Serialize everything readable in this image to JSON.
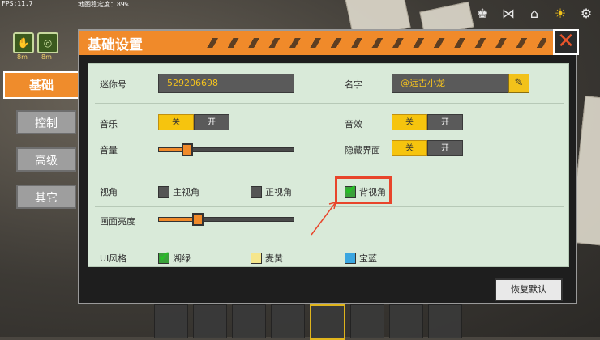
{
  "hud": {
    "fps": "FPS:11.7",
    "stability": "地图稳定度：89%"
  },
  "buffs": [
    {
      "icon": "hunger-icon",
      "time": "8m"
    },
    {
      "icon": "spiral-icon",
      "time": "8m"
    }
  ],
  "side_tabs": [
    "基础",
    "控制",
    "高级",
    "其它"
  ],
  "panel": {
    "title": "基础设置",
    "close_icon": "close-icon"
  },
  "settings": {
    "mini_id_label": "迷你号",
    "mini_id_value": "529206698",
    "name_label": "名字",
    "name_value": "@远古小龙",
    "music_label": "音乐",
    "sound_label": "音效",
    "volume_label": "音量",
    "hide_ui_label": "隐藏界面",
    "toggle_off": "关",
    "toggle_on": "开",
    "view_label": "视角",
    "view_options": [
      "主视角",
      "正视角",
      "背视角"
    ],
    "brightness_label": "画面亮度",
    "ui_style_label": "UI风格",
    "ui_style_options": [
      "湖绿",
      "麦黄",
      "宝蓝"
    ],
    "restore_label": "恢复默认"
  },
  "values": {
    "volume": 0.21,
    "brightness": 0.29
  },
  "colors": {
    "accent": "#f08a2a",
    "toggle_active": "#f6c40e",
    "highlight": "#e8452b",
    "style_green": "#3aa13a",
    "style_yellow": "#f5e68c",
    "style_blue": "#3aa6e0"
  }
}
